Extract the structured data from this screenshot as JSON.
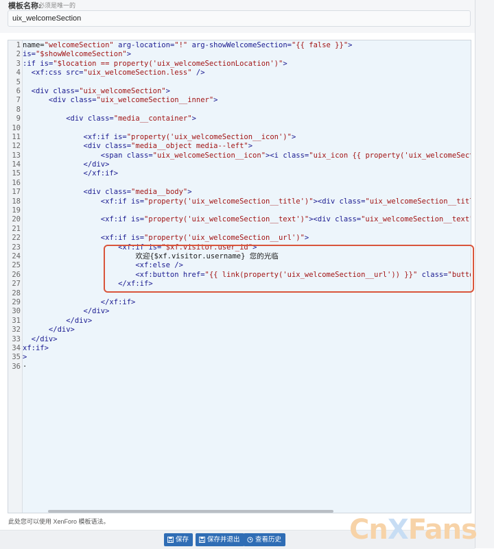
{
  "header": {
    "label": "模板名称:",
    "hint": "必须是唯一的",
    "template_name": "uix_welcomeSection"
  },
  "editor": {
    "lines": [
      {
        "n": "1",
        "parts": [
          [
            "tx",
            "name="
          ],
          [
            "st",
            "\"welcomeSection\""
          ],
          [
            "at",
            " arg-location="
          ],
          [
            "st",
            "\"!\""
          ],
          [
            "at",
            " arg-showWelcomeSection="
          ],
          [
            "st",
            "\"{{ false }}\""
          ],
          [
            "tg",
            ">"
          ]
        ]
      },
      {
        "n": "2",
        "parts": [
          [
            "at",
            "is="
          ],
          [
            "st",
            "\"$showWelcomeSection\""
          ],
          [
            "tg",
            ">"
          ]
        ]
      },
      {
        "n": "3",
        "parts": [
          [
            "tg",
            ":if "
          ],
          [
            "at",
            "is="
          ],
          [
            "st",
            "\"$location == property('uix_welcomeSectionLocation')\""
          ],
          [
            "tg",
            ">"
          ]
        ]
      },
      {
        "n": "4",
        "parts": [
          [
            "tg",
            "  <xf:css "
          ],
          [
            "at",
            "src="
          ],
          [
            "st",
            "\"uix_welcomeSection.less\""
          ],
          [
            "tg",
            " />"
          ]
        ]
      },
      {
        "n": "5",
        "parts": []
      },
      {
        "n": "6",
        "parts": [
          [
            "tg",
            "  <div "
          ],
          [
            "at",
            "class="
          ],
          [
            "st",
            "\"uix_welcomeSection\""
          ],
          [
            "tg",
            ">"
          ]
        ]
      },
      {
        "n": "7",
        "parts": [
          [
            "tg",
            "      <div "
          ],
          [
            "at",
            "class="
          ],
          [
            "st",
            "\"uix_welcomeSection__inner\""
          ],
          [
            "tg",
            ">"
          ]
        ]
      },
      {
        "n": "8",
        "parts": []
      },
      {
        "n": "9",
        "parts": [
          [
            "tg",
            "          <div "
          ],
          [
            "at",
            "class="
          ],
          [
            "st",
            "\"media__container\""
          ],
          [
            "tg",
            ">"
          ]
        ]
      },
      {
        "n": "10",
        "parts": []
      },
      {
        "n": "11",
        "parts": [
          [
            "tg",
            "              <xf:if "
          ],
          [
            "at",
            "is="
          ],
          [
            "st",
            "\"property('uix_welcomeSection__icon')\""
          ],
          [
            "tg",
            ">"
          ]
        ]
      },
      {
        "n": "12",
        "parts": [
          [
            "tg",
            "              <div "
          ],
          [
            "at",
            "class="
          ],
          [
            "st",
            "\"media__object media--left\""
          ],
          [
            "tg",
            ">"
          ]
        ]
      },
      {
        "n": "13",
        "parts": [
          [
            "tg",
            "                  <span "
          ],
          [
            "at",
            "class="
          ],
          [
            "st",
            "\"uix_welcomeSection__icon\""
          ],
          [
            "tg",
            "><i "
          ],
          [
            "at",
            "class="
          ],
          [
            "st",
            "\"uix_icon {{ property('uix_welcomeSection__icon')"
          ]
        ]
      },
      {
        "n": "14",
        "parts": [
          [
            "tg",
            "              </div>"
          ]
        ]
      },
      {
        "n": "15",
        "parts": [
          [
            "tg",
            "              </xf:if>"
          ]
        ]
      },
      {
        "n": "16",
        "parts": []
      },
      {
        "n": "17",
        "parts": [
          [
            "tg",
            "              <div "
          ],
          [
            "at",
            "class="
          ],
          [
            "st",
            "\"media__body\""
          ],
          [
            "tg",
            ">"
          ]
        ]
      },
      {
        "n": "18",
        "parts": [
          [
            "tg",
            "                  <xf:if "
          ],
          [
            "at",
            "is="
          ],
          [
            "st",
            "\"property('uix_welcomeSection__title')\""
          ],
          [
            "tg",
            "><div "
          ],
          [
            "at",
            "class="
          ],
          [
            "st",
            "\"uix_welcomeSection__title\""
          ],
          [
            "tg",
            ">{{ prope"
          ]
        ]
      },
      {
        "n": "19",
        "parts": []
      },
      {
        "n": "20",
        "parts": [
          [
            "tg",
            "                  <xf:if "
          ],
          [
            "at",
            "is="
          ],
          [
            "st",
            "\"property('uix_welcomeSection__text')\""
          ],
          [
            "tg",
            "><div "
          ],
          [
            "at",
            "class="
          ],
          [
            "st",
            "\"uix_welcomeSection__text\""
          ],
          [
            "tg",
            ">{{ propert"
          ]
        ]
      },
      {
        "n": "21",
        "parts": []
      },
      {
        "n": "22",
        "parts": [
          [
            "tg",
            "                  <xf:if "
          ],
          [
            "at",
            "is="
          ],
          [
            "st",
            "\"property('uix_welcomeSection__url')\""
          ],
          [
            "tg",
            ">"
          ]
        ]
      },
      {
        "n": "23",
        "parts": [
          [
            "tg",
            "                      <xf:if "
          ],
          [
            "at",
            "is="
          ],
          [
            "st",
            "\"$xf.visitor.user_id\""
          ],
          [
            "tg",
            ">"
          ]
        ]
      },
      {
        "n": "24",
        "parts": [
          [
            "tx",
            "                          欢迎{$xf.visitor.username} 您的光临"
          ]
        ]
      },
      {
        "n": "25",
        "parts": [
          [
            "tg",
            "                          <xf:else />"
          ]
        ]
      },
      {
        "n": "26",
        "parts": [
          [
            "tg",
            "                          <xf:button "
          ],
          [
            "at",
            "href="
          ],
          [
            "st",
            "\"{{ link(property('uix_welcomeSection__url')) }}\""
          ],
          [
            "at",
            " class="
          ],
          [
            "st",
            "\"button--cta\""
          ],
          [
            "tg",
            ">{{"
          ]
        ]
      },
      {
        "n": "27",
        "parts": [
          [
            "tg",
            "                      </xf:if>"
          ]
        ]
      },
      {
        "n": "28",
        "parts": []
      },
      {
        "n": "29",
        "parts": [
          [
            "tg",
            "                  </xf:if>"
          ]
        ]
      },
      {
        "n": "30",
        "parts": [
          [
            "tg",
            "              </div>"
          ]
        ]
      },
      {
        "n": "31",
        "parts": [
          [
            "tg",
            "          </div>"
          ]
        ]
      },
      {
        "n": "32",
        "parts": [
          [
            "tg",
            "      </div>"
          ]
        ]
      },
      {
        "n": "33",
        "parts": [
          [
            "tg",
            "  </div>"
          ]
        ]
      },
      {
        "n": "34",
        "parts": [
          [
            "tg",
            "xf:if>"
          ]
        ]
      },
      {
        "n": "35",
        "parts": [
          [
            "tg",
            ">"
          ]
        ]
      },
      {
        "n": "36",
        "parts": [
          [
            "tx",
            "·"
          ]
        ]
      }
    ]
  },
  "footnote": "此处您可以使用 XenForo 模板语法。",
  "buttons": {
    "save": "保存",
    "save_exit": "保存并退出",
    "history": "查看历史"
  },
  "watermark": {
    "part1": "Cn",
    "part2": "X",
    "part3": "Fans"
  },
  "colors": {
    "button_bg": "#2f6db5",
    "highlight_border": "#d9543a",
    "editor_bg": "#edf5fb"
  }
}
